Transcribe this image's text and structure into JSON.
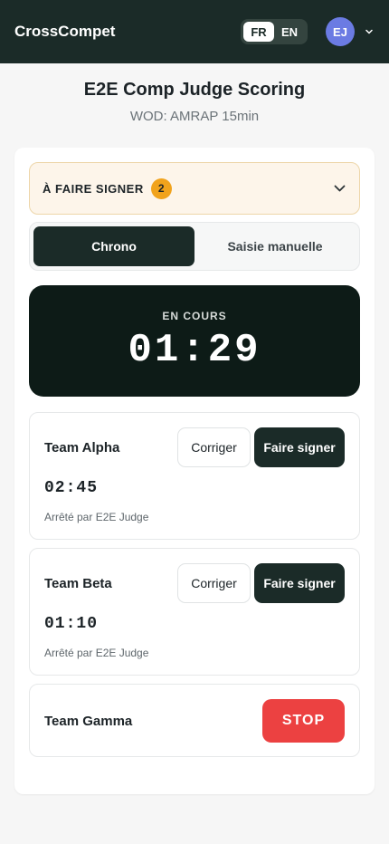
{
  "app": {
    "brand": "CrossCompet",
    "languages": [
      {
        "code": "FR",
        "active": true
      },
      {
        "code": "EN",
        "active": false
      }
    ],
    "user_initials": "EJ"
  },
  "header": {
    "title": "E2E Comp Judge Scoring",
    "subtitle": "WOD: AMRAP 15min"
  },
  "pending": {
    "label": "À FAIRE SIGNER",
    "count": "2"
  },
  "tabs": [
    {
      "label": "Chrono",
      "active": true
    },
    {
      "label": "Saisie manuelle",
      "active": false
    }
  ],
  "timer": {
    "status": "EN COURS",
    "clock": "01:29"
  },
  "teams": [
    {
      "name": "Team Alpha",
      "time": "02:45",
      "note": "Arrêté par E2E Judge",
      "correct_label": "Corriger",
      "sign_label": "Faire signer"
    },
    {
      "name": "Team Beta",
      "time": "01:10",
      "note": "Arrêté par E2E Judge",
      "correct_label": "Corriger",
      "sign_label": "Faire signer"
    },
    {
      "name": "Team Gamma",
      "stop_label": "STOP"
    }
  ],
  "colors": {
    "header_bg": "#1b2b28",
    "accent_dark": "#1b2b28",
    "timer_bg": "#0d1b17",
    "badge": "#f1a31c",
    "stop": "#ec4141",
    "avatar": "#6b7be3"
  },
  "icons": {
    "avatar_menu": "chevron-down-icon",
    "accordion_toggle": "chevron-down-icon"
  }
}
